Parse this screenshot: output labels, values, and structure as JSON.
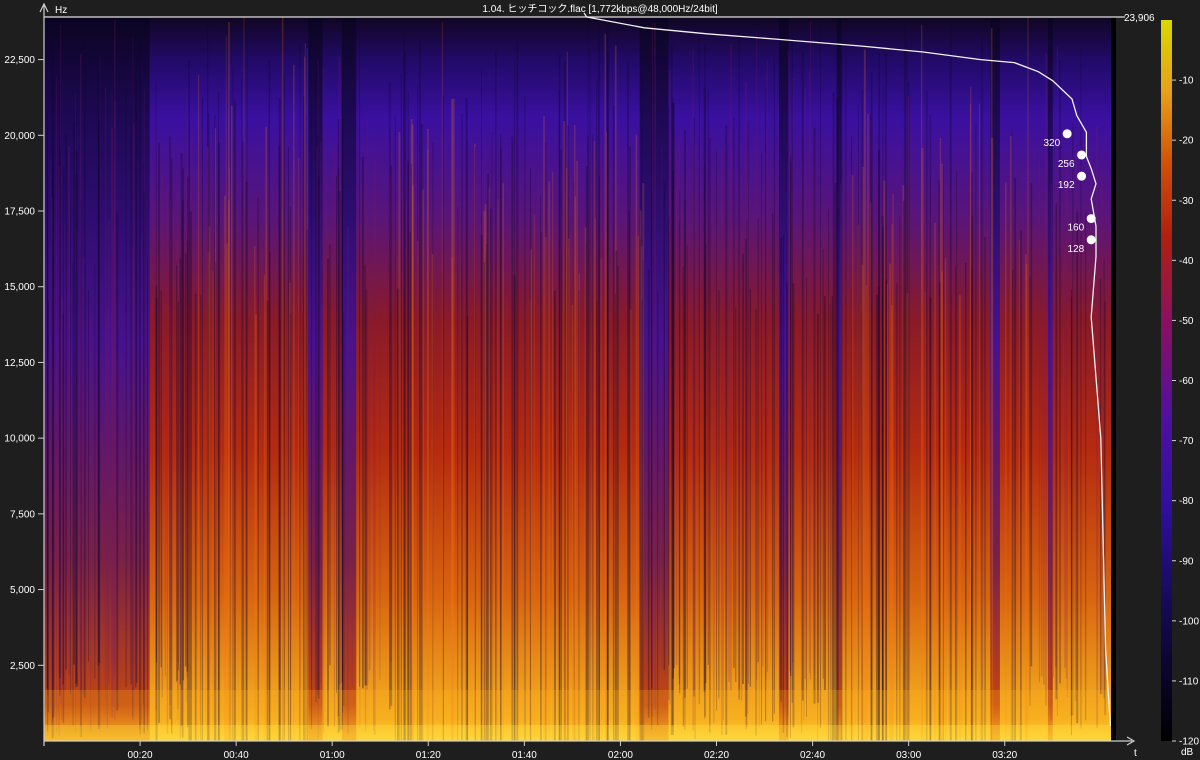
{
  "chart_data": {
    "type": "heatmap",
    "title": "1.04. ヒッチコック.flac [1,772kbps@48,000Hz/24bit]",
    "xlabel": "t",
    "ylabel": "Hz",
    "colorbar_label": "dB",
    "ymax_label": "23,906",
    "y_ticks": [
      "22,500",
      "20,000",
      "17,500",
      "15,000",
      "12,500",
      "10,000",
      "7,500",
      "5,000",
      "2,500"
    ],
    "y_tick_values": [
      22500,
      20000,
      17500,
      15000,
      12500,
      10000,
      7500,
      5000,
      2500
    ],
    "x_ticks": [
      "00:20",
      "00:40",
      "01:00",
      "01:20",
      "01:40",
      "02:00",
      "02:20",
      "02:40",
      "03:00",
      "03:20"
    ],
    "x_tick_seconds": [
      20,
      40,
      60,
      80,
      100,
      120,
      140,
      160,
      180,
      200
    ],
    "db_ticks": [
      "-10",
      "-20",
      "-30",
      "-40",
      "-50",
      "-60",
      "-70",
      "-80",
      "-90",
      "-100",
      "-110",
      "-120"
    ],
    "db_tick_values": [
      -10,
      -20,
      -30,
      -40,
      -50,
      -60,
      -70,
      -80,
      -90,
      -100,
      -110,
      -120
    ],
    "xlim_seconds": [
      0,
      224
    ],
    "ylim_hz": [
      0,
      23906
    ],
    "colorscale": [
      "#000000",
      "#1a0a55",
      "#3a0aa0",
      "#5a10a0",
      "#8a1060",
      "#b02010",
      "#d04008",
      "#e07010",
      "#f0b020",
      "#ffe040"
    ],
    "cutoff_curve": {
      "t": [
        113,
        125,
        138,
        152,
        170,
        183,
        195,
        202,
        207,
        210,
        214,
        215,
        217,
        217,
        217,
        218,
        219,
        218,
        219,
        219,
        218,
        219,
        220,
        221,
        222
      ],
      "hz": [
        23906,
        23550,
        23350,
        23180,
        22950,
        22750,
        22500,
        22400,
        22100,
        21800,
        21200,
        20650,
        20100,
        19700,
        19300,
        18900,
        18400,
        17900,
        17000,
        16000,
        14000,
        12000,
        10000,
        3000,
        500
      ]
    },
    "bitrate_markers": [
      {
        "label": "320",
        "t": 213,
        "hz": 20050
      },
      {
        "label": "256",
        "t": 216,
        "hz": 19350
      },
      {
        "label": "192",
        "t": 216,
        "hz": 18650
      },
      {
        "label": "160",
        "t": 218,
        "hz": 17250
      },
      {
        "label": "128",
        "t": 218,
        "hz": 16550
      }
    ],
    "quiet_regions_seconds": [
      [
        0,
        22
      ],
      [
        55,
        58
      ],
      [
        62,
        65
      ],
      [
        124,
        130
      ],
      [
        153,
        155
      ],
      [
        165,
        166
      ],
      [
        197,
        199
      ],
      [
        209,
        210
      ]
    ],
    "loud_regions_seconds": [
      [
        30,
        55
      ],
      [
        73,
        125
      ],
      [
        163,
        205
      ]
    ]
  }
}
